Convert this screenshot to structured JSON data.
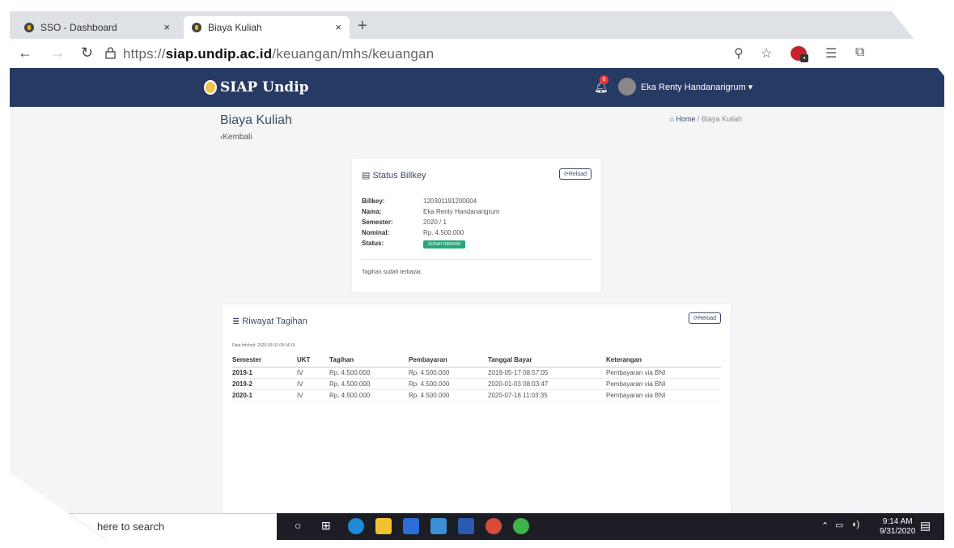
{
  "browser": {
    "tabs": [
      {
        "title": "SSO - Dashboard",
        "close": "×"
      },
      {
        "title": "Biaya Kuliah",
        "close": "×"
      }
    ],
    "new_tab": "+",
    "url_prefix": "https://",
    "url_domain": "siap.undip.ac.id",
    "url_path": "/keuangan/mhs/keuangan"
  },
  "site": {
    "brand": "SIAP Undip",
    "notification_count": "8",
    "user_name": "Eka Renty Handanarigrum"
  },
  "page": {
    "title": "Biaya Kuliah",
    "back_label": "Kembali",
    "breadcrumb_home": "Home",
    "breadcrumb_sep": "/",
    "breadcrumb_current": "Biaya Kuliah"
  },
  "status_card": {
    "title": "Status Billkey",
    "reload_label": "Reload",
    "fields": [
      {
        "label": "Billkey:",
        "value": "120301191200004"
      },
      {
        "label": "Nama:",
        "value": "Eka Renty Handanarigrum"
      },
      {
        "label": "Semester:",
        "value": "2020 / 1"
      },
      {
        "label": "Nominal:",
        "value": "Rp. 4.500.000"
      },
      {
        "label": "Status:",
        "value": "SUDAH DIBAYAR"
      }
    ],
    "note": "Tagihan sudah terbayar."
  },
  "history_card": {
    "title": "Riwayat Tagihan",
    "reload_label": "Reload",
    "fetched": "Data fetched: 2020-09-31 09:14:15",
    "columns": [
      "Semester",
      "UKT",
      "Tagihan",
      "Pembayaran",
      "Tanggal Bayar",
      "Keterangan"
    ],
    "rows": [
      [
        "2019-1",
        "IV",
        "Rp. 4.500.000",
        "Rp. 4.500.000",
        "2019-05-17 08:57:05",
        "Pembayaran via BNI"
      ],
      [
        "2019-2",
        "IV",
        "Rp. 4.500.000",
        "Rp. 4.500.000",
        "2020-01-03 08:03:47",
        "Pembayaran via BNI"
      ],
      [
        "2020-1",
        "IV",
        "Rp. 4.500.000",
        "Rp. 4.500.000",
        "2020-07-16 11:03:35",
        "Pembayaran via BNI"
      ]
    ]
  },
  "taskbar": {
    "search_text": "here to search",
    "time": "9:14 AM",
    "date": "9/31/2020"
  },
  "colors": {
    "header": "#273a63",
    "accent": "#3d4b66",
    "status_badge": "#28a779"
  }
}
